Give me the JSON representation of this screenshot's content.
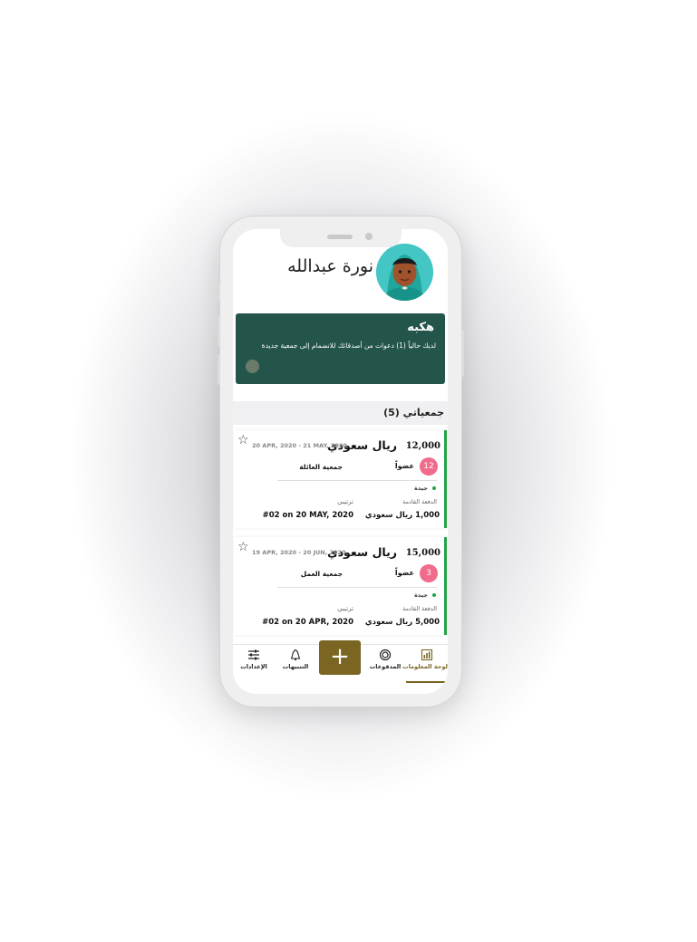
{
  "profile": {
    "name": "نورة عبدالله"
  },
  "invite_banner": {
    "title": "هكبه",
    "message": "لديك حالياً (1) دعوات من أصدقائك للانضمام إلى جمعية جديدة"
  },
  "my_groups": {
    "title": "جمعياتي (5)"
  },
  "cards": [
    {
      "amount": "12,000",
      "currency": "ريال سعودي",
      "dates": "20 APR, 2020 - 21 MAY, 2020",
      "member_count": "12",
      "members_label": "عضواً",
      "group_name": "جمعية العائلة",
      "status": "جيدة",
      "next_payment_label": "الدفعة القادمة",
      "next_payment_value": "1,000 ريال سعودي",
      "order_label": "ترتيبي",
      "order_value": "#02 on 20 MAY, 2020"
    },
    {
      "amount": "15,000",
      "currency": "ريال سعودي",
      "dates": "19 APR, 2020 - 20 JUN, 2020",
      "member_count": "3",
      "members_label": "عضواً",
      "group_name": "جمعية العمل",
      "status": "جيدة",
      "next_payment_label": "الدفعة القادمة",
      "next_payment_value": "5,000 ريال سعودي",
      "order_label": "ترتيبي",
      "order_value": "#02 on 20 APR, 2020"
    }
  ],
  "nav": {
    "settings": "الإعدادات",
    "alerts": "التنبيهات",
    "add": "+",
    "payments": "المدفوعات",
    "dashboard": "لوحة المعلومات"
  },
  "colors": {
    "banner": "#23554a",
    "accent": "#7a6522",
    "status_green": "#22a447",
    "badge_pink": "#f06b8c"
  }
}
